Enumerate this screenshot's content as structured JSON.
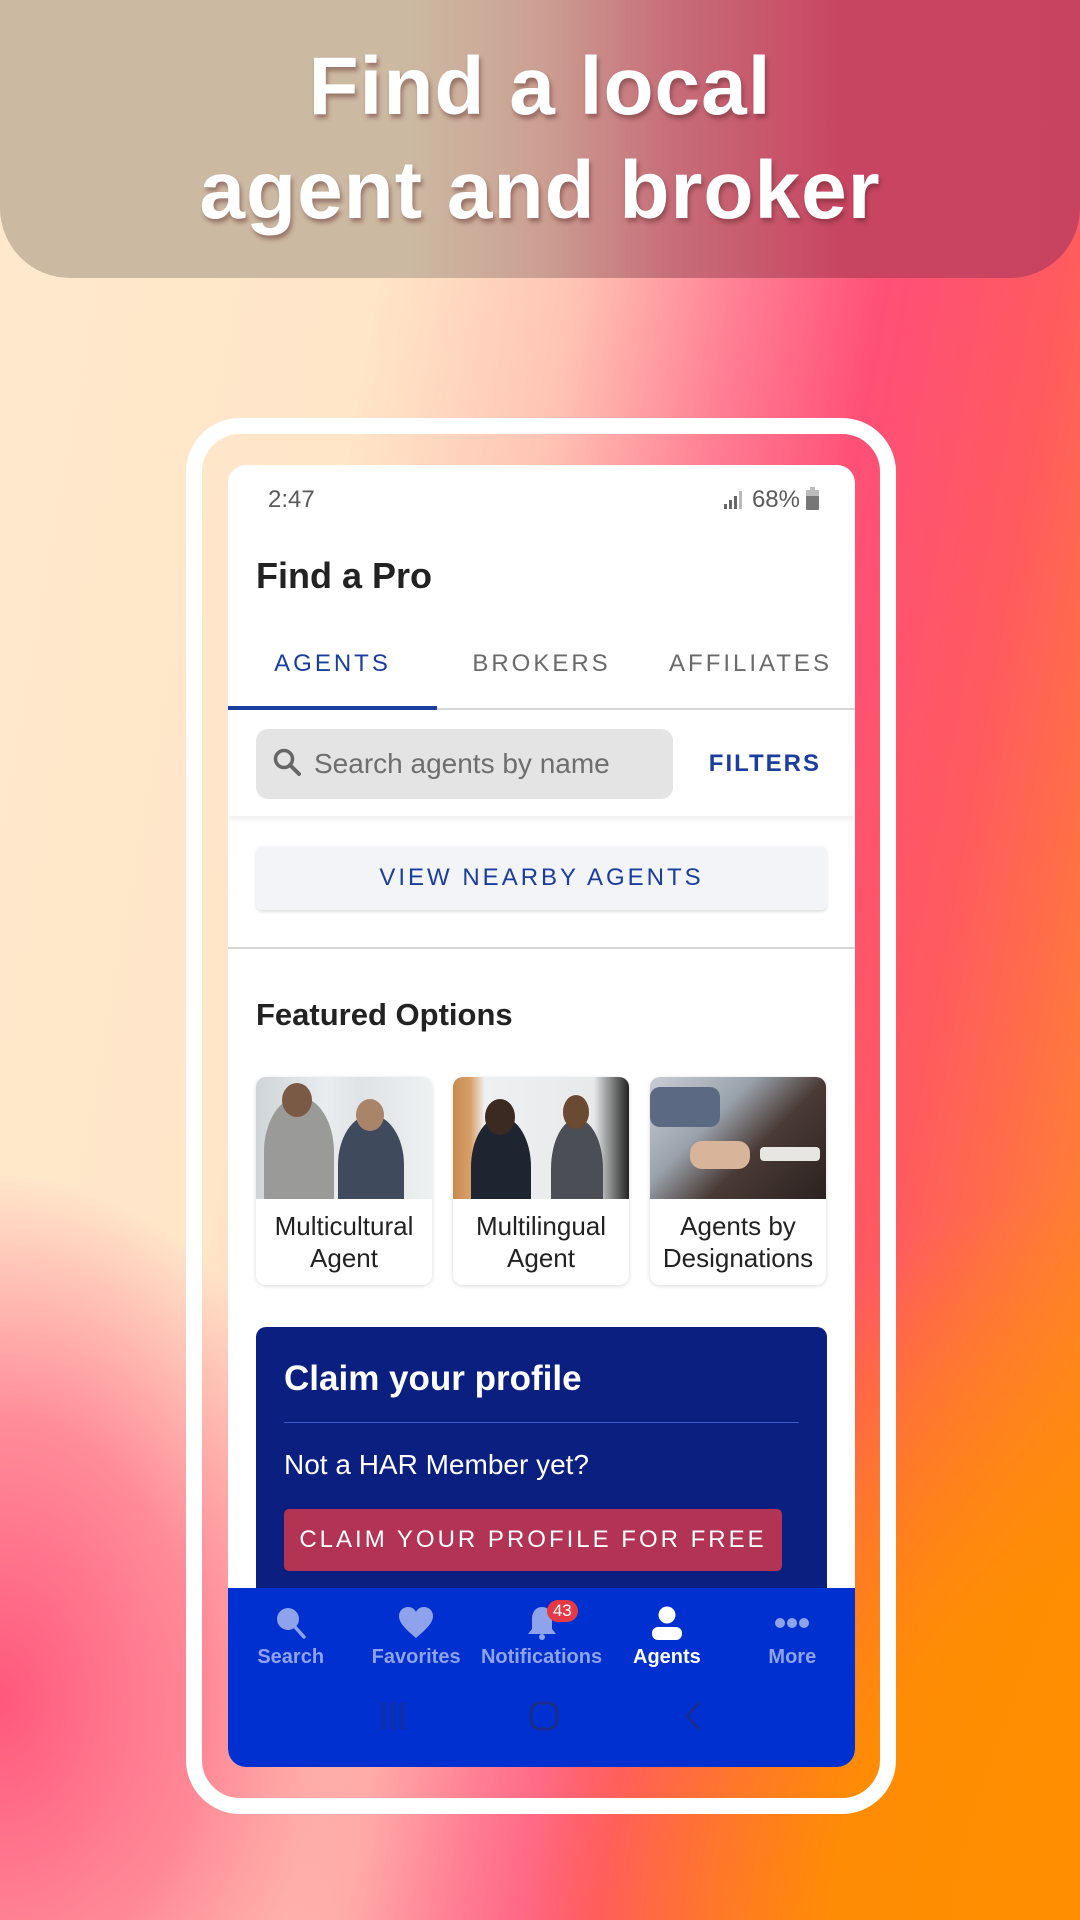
{
  "hero": {
    "line1": "Find a local",
    "line2": "agent and broker"
  },
  "status_bar": {
    "time": "2:47",
    "battery": "68%",
    "signal_icon": "signal-icon",
    "battery_icon": "battery-icon"
  },
  "page": {
    "title": "Find a Pro"
  },
  "tabs": [
    {
      "label": "AGENTS",
      "active": true
    },
    {
      "label": "BROKERS",
      "active": false
    },
    {
      "label": "AFFILIATES",
      "active": false
    }
  ],
  "search": {
    "placeholder": "Search agents by name",
    "value": "",
    "filters_label": "FILTERS"
  },
  "nearby_button": "VIEW NEARBY AGENTS",
  "featured": {
    "title": "Featured Options",
    "cards": [
      {
        "line1": "Multicultural",
        "line2": "Agent",
        "image": "two men looking at phone"
      },
      {
        "line1": "Multilingual",
        "line2": "Agent",
        "image": "two women talking by window"
      },
      {
        "line1": "Agents by",
        "line2": "Designations",
        "image": "people writing at table"
      }
    ]
  },
  "claim": {
    "title": "Claim your profile",
    "subtitle": "Not a HAR Member yet?",
    "button": "CLAIM YOUR PROFILE FOR FREE"
  },
  "bottom_nav": [
    {
      "label": "Search",
      "icon": "search-icon",
      "active": false
    },
    {
      "label": "Favorites",
      "icon": "heart-icon",
      "active": false
    },
    {
      "label": "Notifications",
      "icon": "bell-icon",
      "active": false,
      "badge": "43"
    },
    {
      "label": "Agents",
      "icon": "person-icon",
      "active": true
    },
    {
      "label": "More",
      "icon": "more-dots-icon",
      "active": false
    }
  ],
  "colors": {
    "primary_blue": "#1a3d9e",
    "nav_blue": "#0030cf",
    "claim_navy": "#0a1f80",
    "claim_button": "#b33355",
    "badge_red": "#e63946"
  }
}
